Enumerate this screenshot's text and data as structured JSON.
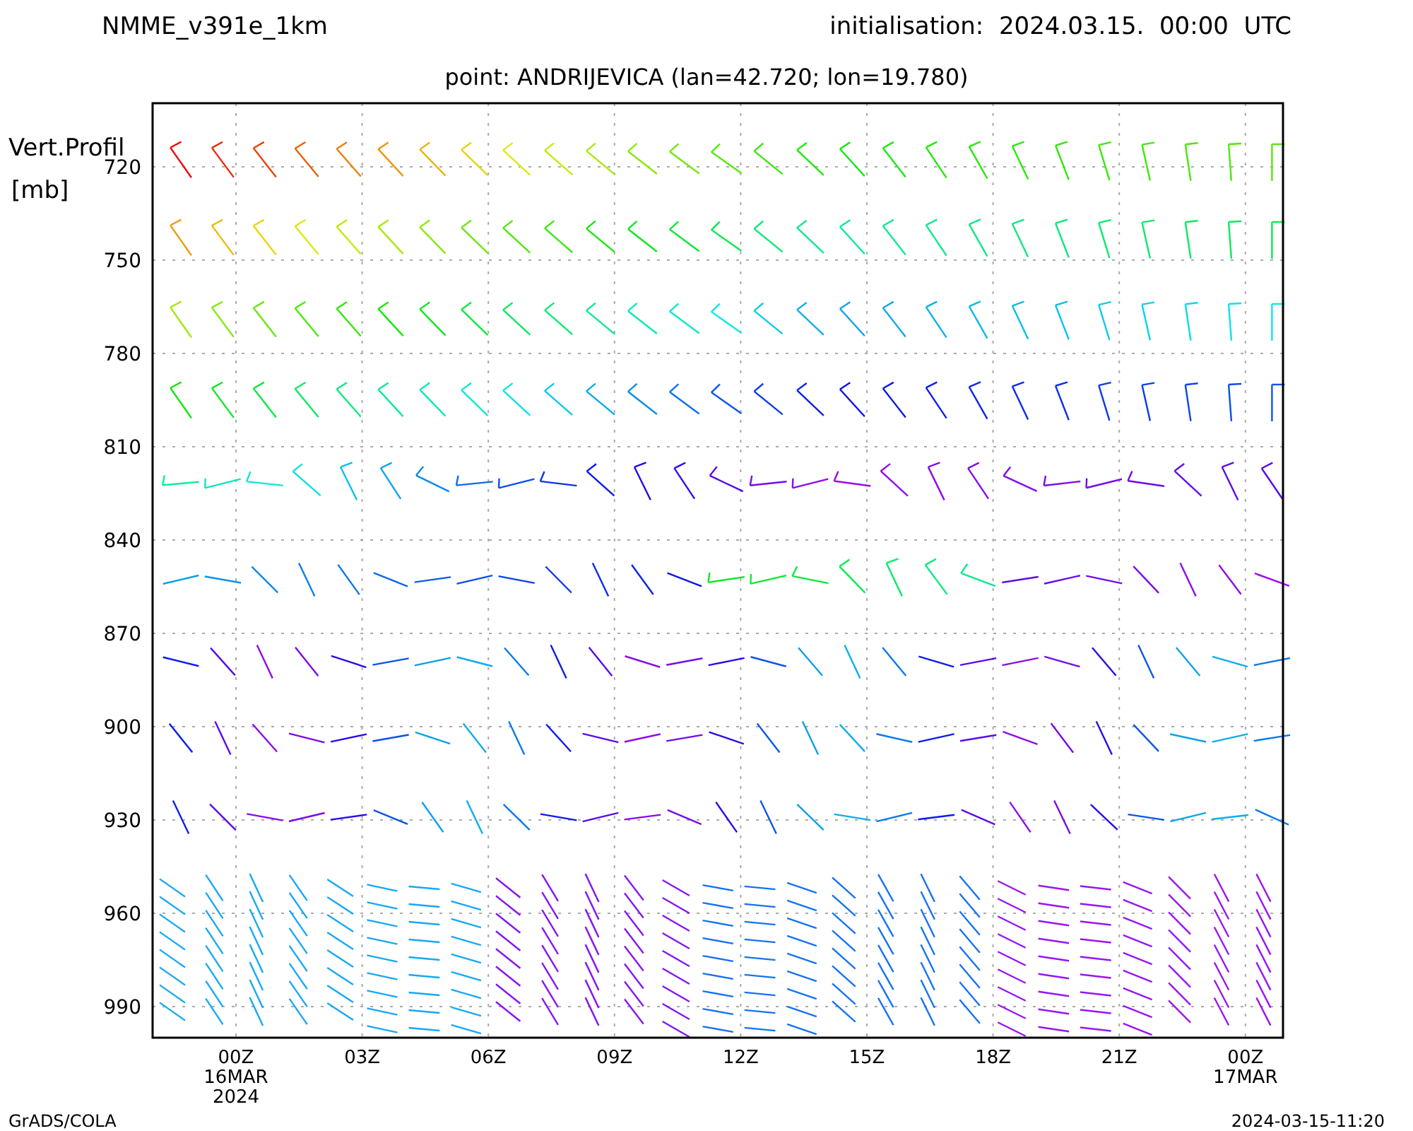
{
  "header": {
    "model": "NMME_v391e_1km",
    "initialisation": "initialisation:  2024.03.15.  00:00  UTC"
  },
  "title": "point: ANDRIJEVICA (lan=42.720; lon=19.780)",
  "plot": {
    "ylabel": [
      "Vert.Profil",
      "[mb]"
    ],
    "yticks": [
      "720",
      "750",
      "780",
      "810",
      "840",
      "870",
      "900",
      "930",
      "960",
      "990"
    ],
    "xticks": [
      {
        "lines": [
          "00Z",
          "16MAR",
          "2024"
        ]
      },
      {
        "lines": [
          "03Z"
        ]
      },
      {
        "lines": [
          "06Z"
        ]
      },
      {
        "lines": [
          "09Z"
        ]
      },
      {
        "lines": [
          "12Z"
        ]
      },
      {
        "lines": [
          "15Z"
        ]
      },
      {
        "lines": [
          "18Z"
        ]
      },
      {
        "lines": [
          "21Z"
        ]
      },
      {
        "lines": [
          "00Z",
          "17MAR"
        ]
      }
    ]
  },
  "footer": {
    "left": "GrADS/COLA",
    "right": "2024-03-15-11:20"
  }
}
